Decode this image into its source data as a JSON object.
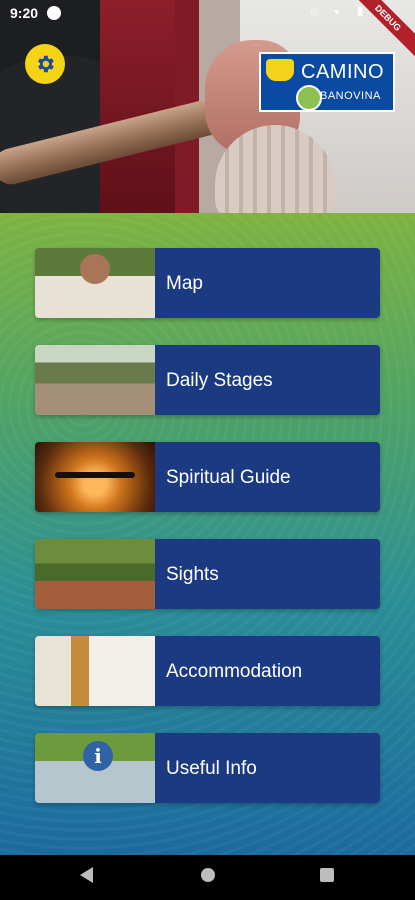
{
  "status_bar": {
    "time": "9:20",
    "icons": "⌾ ▾ ▮",
    "debug_label": "DEBUG"
  },
  "header": {
    "logo_text": "CAMINO",
    "logo_subtext": "BANOVINA",
    "settings_icon": "gear-icon",
    "settings_color": "#f5d417"
  },
  "menu": {
    "items": [
      {
        "label": "Map"
      },
      {
        "label": "Daily Stages"
      },
      {
        "label": "Spiritual Guide"
      },
      {
        "label": "Sights"
      },
      {
        "label": "Accommodation"
      },
      {
        "label": "Useful Info"
      }
    ],
    "item_color": "#1b3a82"
  },
  "nav": {
    "back_icon": "back-icon",
    "home_icon": "home-icon",
    "recent_icon": "recents-icon"
  }
}
